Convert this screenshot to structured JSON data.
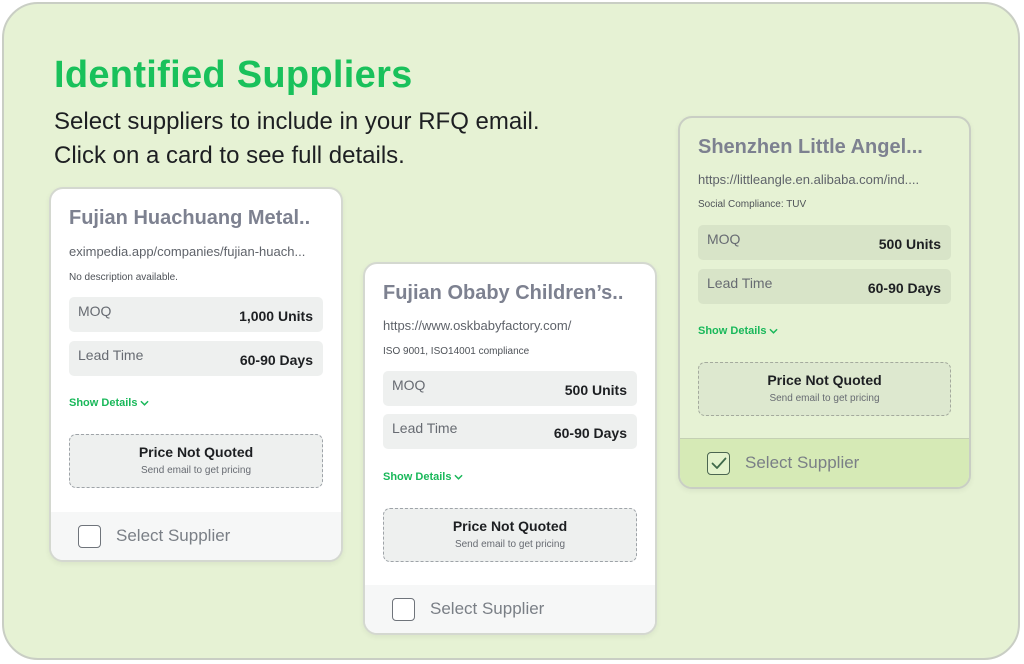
{
  "heading": {
    "title": "Identified Suppliers",
    "line1": "Select suppliers to include in your RFQ email.",
    "line2": "Click on a card to see full details."
  },
  "colors": {
    "accent": "#19c15b",
    "background": "#e6f2d4",
    "selected_bar": "#d6eab6"
  },
  "icons": {
    "chevron": "chevron-down-icon",
    "check": "checkmark-icon"
  },
  "suppliers": [
    {
      "name": "Fujian Huachuang Metal..",
      "url": "eximpedia.app/companies/fujian-huach...",
      "description": "No description available.",
      "moq_label": "MOQ",
      "moq_value": "1,000 Units",
      "lead_label": "Lead Time",
      "lead_value": "60-90 Days",
      "show_details": "Show Details",
      "price_title": "Price Not Quoted",
      "price_sub": "Send email to get pricing",
      "select_label": "Select Supplier",
      "selected": false
    },
    {
      "name": "Fujian Obaby Children’s..",
      "url": "https://www.oskbabyfactory.com/",
      "description": "ISO 9001, ISO14001 compliance",
      "moq_label": "MOQ",
      "moq_value": "500 Units",
      "lead_label": "Lead Time",
      "lead_value": "60-90 Days",
      "show_details": "Show Details",
      "price_title": "Price Not Quoted",
      "price_sub": "Send email to get pricing",
      "select_label": "Select Supplier",
      "selected": false
    },
    {
      "name": "Shenzhen Little Angel...",
      "url": "https://littleangle.en.alibaba.com/ind....",
      "description": "Social Compliance: TUV",
      "moq_label": "MOQ",
      "moq_value": "500 Units",
      "lead_label": "Lead Time",
      "lead_value": "60-90 Days",
      "show_details": "Show Details",
      "price_title": "Price Not Quoted",
      "price_sub": "Send email to get pricing",
      "select_label": "Select Supplier",
      "selected": true
    }
  ]
}
